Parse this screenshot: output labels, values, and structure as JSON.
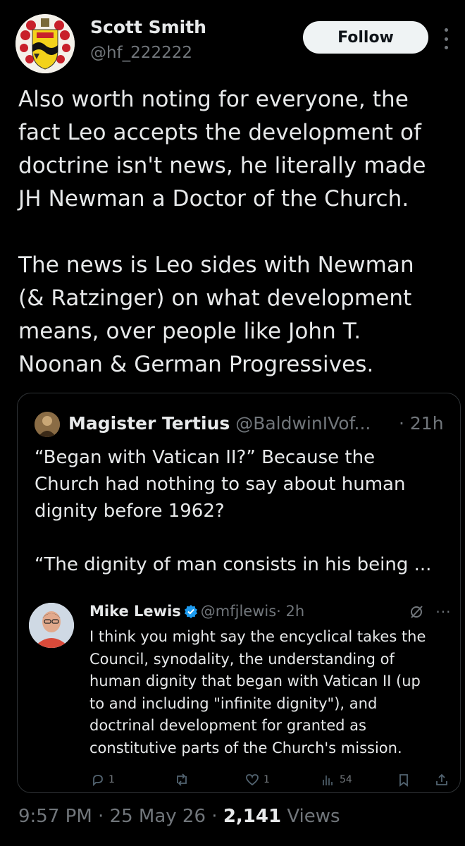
{
  "author": {
    "name": "Scott Smith",
    "handle": "@hf_222222",
    "avatar_icon": "heraldic-shield-icon"
  },
  "follow_label": "Follow",
  "tweet": {
    "paragraph1": [
      "Also worth noting for everyone, the",
      "fact Leo accepts the development of",
      "doctrine isn't news, he literally made",
      "JH Newman a Doctor of the Church."
    ],
    "paragraph2": [
      "The news is Leo sides with Newman",
      "(& Ratzinger) on what development",
      "means, over people like John T.",
      "Noonan & German Progressives."
    ]
  },
  "quote": {
    "name": "Magister Tertius",
    "handle": "@BaldwinIVof...",
    "time": "· 21h",
    "lines1": [
      "“Began with Vatican II?” Because the",
      "Church had nothing to say about human",
      "dignity before 1962?"
    ],
    "line2": "“The dignity of man consists in his being ...",
    "embedded": {
      "name": "Mike Lewis",
      "handle": "@mfjlewis",
      "time": "· 2h",
      "lines": [
        "I think you might say the encyclical takes the",
        "Council, synodality, the understanding of",
        "human dignity that began with Vatican II (up",
        "to and including \"infinite dignity\"), and",
        "doctrinal development for granted as",
        "constitutive parts of the Church's mission."
      ],
      "replies": "1",
      "likes": "1",
      "views": "54",
      "accent_color": "#1d9bf0"
    }
  },
  "footer": {
    "time": "9:57 PM",
    "sep1": " · ",
    "date": "25 May 26",
    "sep2": " · ",
    "views": "2,141",
    "views_label": " Views"
  }
}
